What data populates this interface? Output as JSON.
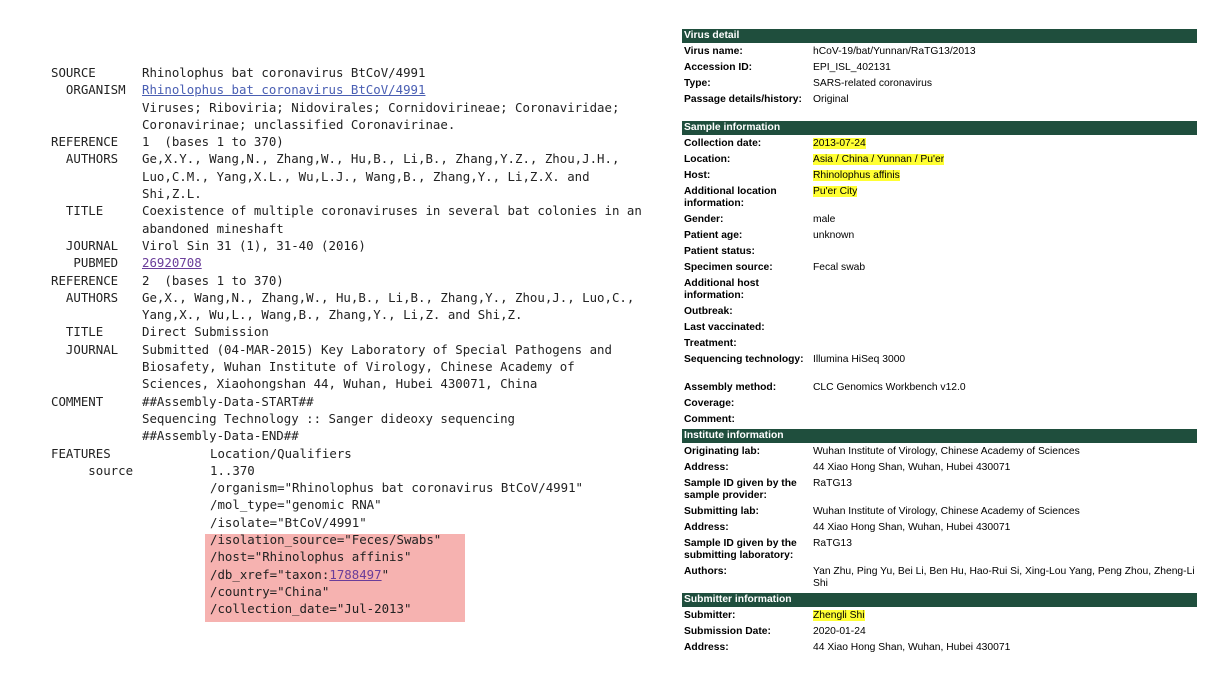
{
  "genbank": {
    "rows": [
      {
        "key": "SOURCE",
        "value": "Rhinolophus bat coronavirus BtCoV/4991"
      },
      {
        "key": "  ORGANISM",
        "value": "Rhinolophus bat coronavirus BtCoV/4991",
        "style": "link"
      },
      {
        "key": "",
        "value": "Viruses; Riboviria; Nidovirales; Cornidovirineae; Coronaviridae;"
      },
      {
        "key": "",
        "value": "Coronavirinae; unclassified Coronavirinae."
      },
      {
        "key": "REFERENCE",
        "value": "1  (bases 1 to 370)"
      },
      {
        "key": "  AUTHORS",
        "value": "Ge,X.Y., Wang,N., Zhang,W., Hu,B., Li,B., Zhang,Y.Z., Zhou,J.H.,"
      },
      {
        "key": "",
        "value": "Luo,C.M., Yang,X.L., Wu,L.J., Wang,B., Zhang,Y., Li,Z.X. and"
      },
      {
        "key": "",
        "value": "Shi,Z.L."
      },
      {
        "key": "  TITLE",
        "value": "Coexistence of multiple coronaviruses in several bat colonies in an"
      },
      {
        "key": "",
        "value": "abandoned mineshaft"
      },
      {
        "key": "  JOURNAL",
        "value": "Virol Sin 31 (1), 31-40 (2016)"
      },
      {
        "key": "   PUBMED",
        "value": "26920708",
        "style": "visited"
      },
      {
        "key": "REFERENCE",
        "value": "2  (bases 1 to 370)"
      },
      {
        "key": "  AUTHORS",
        "value": "Ge,X., Wang,N., Zhang,W., Hu,B., Li,B., Zhang,Y., Zhou,J., Luo,C.,"
      },
      {
        "key": "",
        "value": "Yang,X., Wu,L., Wang,B., Zhang,Y., Li,Z. and Shi,Z."
      },
      {
        "key": "  TITLE",
        "value": "Direct Submission"
      },
      {
        "key": "  JOURNAL",
        "value": "Submitted (04-MAR-2015) Key Laboratory of Special Pathogens and"
      },
      {
        "key": "",
        "value": "Biosafety, Wuhan Institute of Virology, Chinese Academy of"
      },
      {
        "key": "",
        "value": "Sciences, Xiaohongshan 44, Wuhan, Hubei 430071, China"
      },
      {
        "key": "COMMENT",
        "value": "##Assembly-Data-START##"
      },
      {
        "key": "",
        "value": "Sequencing Technology :: Sanger dideoxy sequencing"
      },
      {
        "key": "",
        "value": "##Assembly-Data-END##"
      }
    ],
    "features_key": "FEATURES",
    "features_header": "Location/Qualifiers",
    "source_key": "     source",
    "source_range": "1..370",
    "qualifiers": [
      {
        "text": "/organism=\"Rhinolophus bat coronavirus BtCoV/4991\""
      },
      {
        "text": "/mol_type=\"genomic RNA\""
      },
      {
        "text": "/isolate=\"BtCoV/4991\""
      },
      {
        "text": "/isolation_source=\"Feces/Swabs\""
      },
      {
        "text": "/host=\"Rhinolophus affinis\""
      },
      {
        "prefix": "/db_xref=\"taxon:",
        "link": "1788497",
        "suffix": "\""
      },
      {
        "text": "/country=\"China\""
      },
      {
        "text": "/collection_date=\"Jul-2013\""
      }
    ],
    "highlight_color": "#f6b2b0"
  },
  "gisaid": {
    "header_color": "#1f4e3d",
    "highlight_color": "#ffff33",
    "sections": [
      {
        "title": "Virus detail",
        "fields": [
          {
            "label": "Virus name:",
            "value": "hCoV-19/bat/Yunnan/RaTG13/2013"
          },
          {
            "label": "Accession ID:",
            "value": "EPI_ISL_402131"
          },
          {
            "label": "Type:",
            "value": "SARS-related coronavirus"
          },
          {
            "label": "Passage details/history:",
            "value": "Original",
            "tall": true
          }
        ]
      },
      {
        "title": "Sample information",
        "fields": [
          {
            "label": "Collection date:",
            "value": "2013-07-24",
            "highlight": true
          },
          {
            "label": "Location:",
            "value": "Asia / China / Yunnan / Pu'er",
            "highlight": true
          },
          {
            "label": "Host:",
            "value": "Rhinolophus affinis",
            "highlight": true
          },
          {
            "label": "Additional location information:",
            "value": "Pu'er City",
            "highlight": true,
            "tall": true
          },
          {
            "label": "Gender:",
            "value": "male"
          },
          {
            "label": "Patient age:",
            "value": "unknown"
          },
          {
            "label": "Patient status:",
            "value": ""
          },
          {
            "label": "Specimen source:",
            "value": "Fecal swab"
          },
          {
            "label": "Additional host information:",
            "value": "",
            "tall": true
          },
          {
            "label": "Outbreak:",
            "value": ""
          },
          {
            "label": "Last vaccinated:",
            "value": ""
          },
          {
            "label": "Treatment:",
            "value": ""
          },
          {
            "label": "Sequencing technology:",
            "value": "Illumina HiSeq 3000",
            "tall": true
          },
          {
            "label": "Assembly method:",
            "value": "CLC Genomics Workbench v12.0"
          },
          {
            "label": "Coverage:",
            "value": ""
          },
          {
            "label": "Comment:",
            "value": ""
          }
        ]
      },
      {
        "title": "Institute information",
        "fields": [
          {
            "label": "Originating lab:",
            "value": "Wuhan Institute of Virology, Chinese Academy of Sciences"
          },
          {
            "label": "Address:",
            "value": "44 Xiao Hong Shan, Wuhan,  Hubei 430071"
          },
          {
            "label": "Sample ID given by the sample provider:",
            "value": "RaTG13",
            "tall": true
          },
          {
            "label": "Submitting lab:",
            "value": "Wuhan Institute of Virology, Chinese Academy of Sciences"
          },
          {
            "label": "Address:",
            "value": "44 Xiao Hong Shan, Wuhan,  Hubei 430071"
          },
          {
            "label": "Sample ID given by the submitting laboratory:",
            "value": "RaTG13",
            "tall": true
          },
          {
            "label": "Authors:",
            "value": "Yan Zhu, Ping Yu, Bei Li, Ben Hu, Hao-Rui Si, Xing-Lou Yang, Peng Zhou, Zheng-Li Shi",
            "tall": true
          }
        ]
      },
      {
        "title": "Submitter information",
        "fields": [
          {
            "label": "Submitter:",
            "value": "Zhengli Shi",
            "highlight": true
          },
          {
            "label": "Submission Date:",
            "value": "2020-01-24"
          },
          {
            "label": "Address:",
            "value": "44 Xiao Hong Shan, Wuhan,  Hubei 430071"
          }
        ]
      }
    ]
  }
}
